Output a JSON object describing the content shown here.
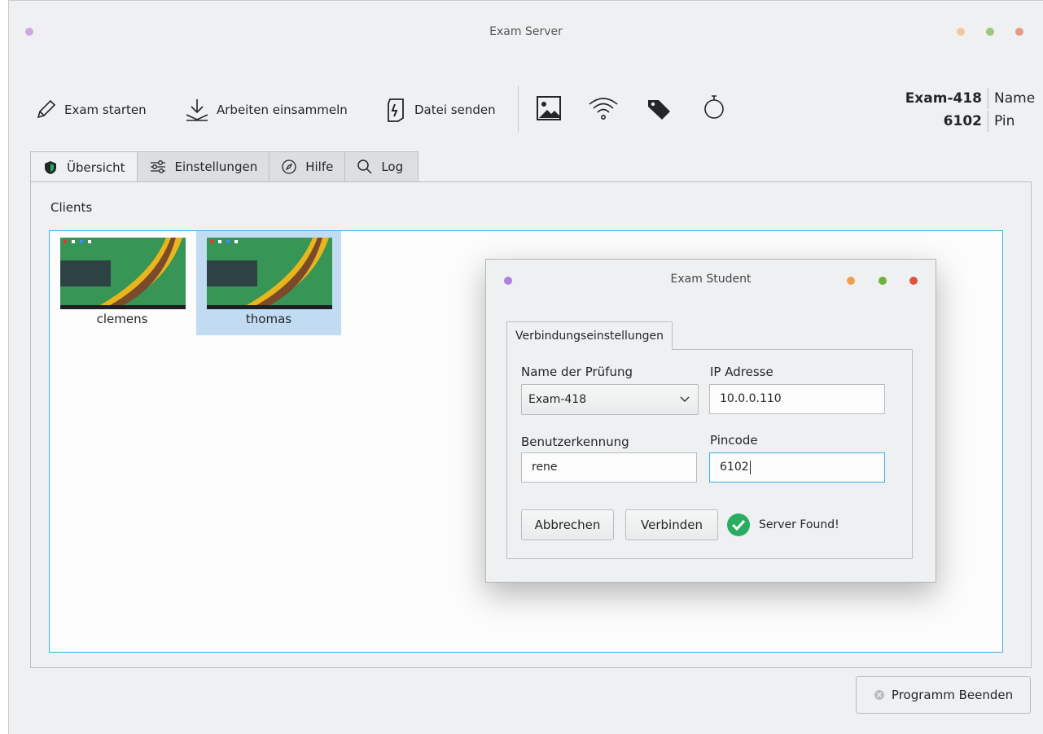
{
  "window": {
    "title": "Exam Server"
  },
  "toolbar": {
    "start_exam": "Exam starten",
    "collect_work": "Arbeiten einsammeln",
    "send_file": "Datei senden",
    "icons": [
      "image-icon",
      "wifi-icon",
      "tag-icon",
      "stopwatch-icon"
    ]
  },
  "exam_info": {
    "exam_value": "Exam-418",
    "exam_label": "Name",
    "pin_value": "6102",
    "pin_label": "Pin"
  },
  "tabs": [
    {
      "label": "Übersicht",
      "icon": "shield-icon",
      "active": true
    },
    {
      "label": "Einstellungen",
      "icon": "sliders-icon",
      "active": false
    },
    {
      "label": "Hilfe",
      "icon": "compass-icon",
      "active": false
    },
    {
      "label": "Log",
      "icon": "search-icon",
      "active": false
    }
  ],
  "clients": {
    "label": "Clients",
    "items": [
      {
        "name": "clemens",
        "selected": false
      },
      {
        "name": "thomas",
        "selected": true
      }
    ]
  },
  "footer": {
    "quit_label": "Programm Beenden"
  },
  "dialog": {
    "title": "Exam Student",
    "tab": "Verbindungseinstellungen",
    "exam_name_label": "Name der Prüfung",
    "exam_name_value": "Exam-418",
    "ip_label": "IP Adresse",
    "ip_value": "10.0.0.110",
    "user_label": "Benutzerkennung",
    "user_value": "rene",
    "pin_label": "Pincode",
    "pin_value": "6102",
    "cancel_label": "Abbrechen",
    "connect_label": "Verbinden",
    "status_text": "Server Found!"
  },
  "colors": {
    "accent": "#3daee9",
    "selection": "#c1dcf2",
    "success": "#27ae60",
    "dot_purple": "#b27fdd",
    "dot_orange": "#f0a04b",
    "dot_green": "#6bb33a",
    "dot_red": "#e0523b"
  }
}
